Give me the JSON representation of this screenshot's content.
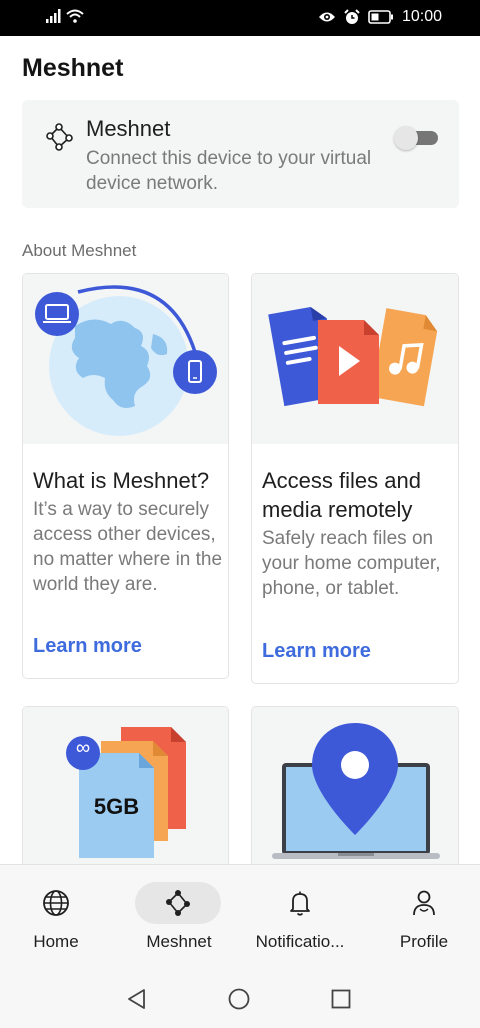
{
  "status_bar": {
    "time": "10:00"
  },
  "page": {
    "title": "Meshnet"
  },
  "meshnet_toggle": {
    "title": "Meshnet",
    "description": "Connect this device to your virtual device network.",
    "enabled": false
  },
  "about": {
    "label": "About Meshnet",
    "cards": [
      {
        "title": "What is Meshnet?",
        "text": "It’s a way to securely access other devices, no matter where in the world they are.",
        "link": "Learn more"
      },
      {
        "title": "Access files and media remotely",
        "text": "Safely reach files on your home computer, phone, or tablet.",
        "link": "Learn more"
      },
      {
        "badge": "5GB",
        "icon": "infinity-icon"
      },
      {
        "icon": "location-pin-icon"
      }
    ]
  },
  "bottom_nav": {
    "items": [
      {
        "label": "Home",
        "icon": "globe-icon",
        "active": false
      },
      {
        "label": "Meshnet",
        "icon": "meshnet-icon",
        "active": true
      },
      {
        "label": "Notificatio...",
        "icon": "bell-icon",
        "active": false
      },
      {
        "label": "Profile",
        "icon": "profile-icon",
        "active": false
      }
    ]
  },
  "colors": {
    "accent": "#3e6bdd",
    "card_bg": "#f4f5f5",
    "muted_text": "#7a7a7a"
  }
}
